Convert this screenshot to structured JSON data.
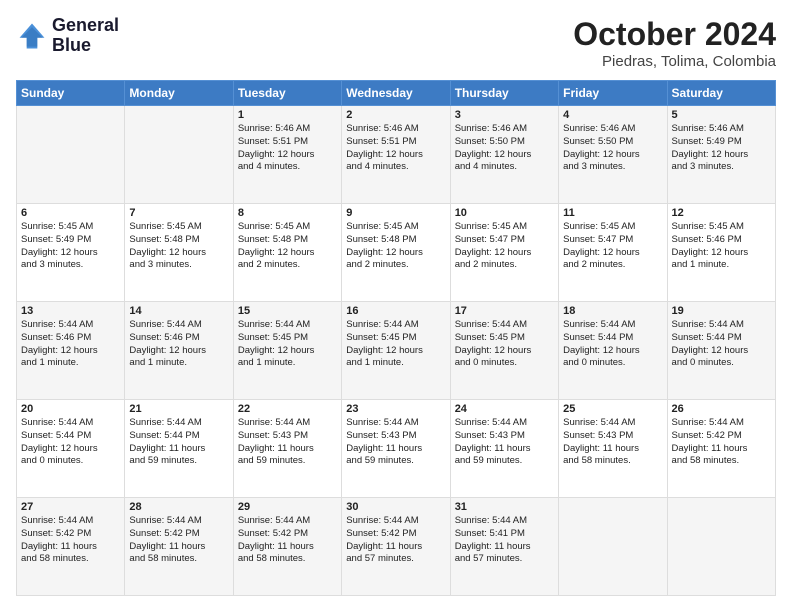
{
  "logo": {
    "line1": "General",
    "line2": "Blue"
  },
  "title": "October 2024",
  "location": "Piedras, Tolima, Colombia",
  "days_header": [
    "Sunday",
    "Monday",
    "Tuesday",
    "Wednesday",
    "Thursday",
    "Friday",
    "Saturday"
  ],
  "weeks": [
    [
      {
        "day": "",
        "content": ""
      },
      {
        "day": "",
        "content": ""
      },
      {
        "day": "1",
        "content": "Sunrise: 5:46 AM\nSunset: 5:51 PM\nDaylight: 12 hours\nand 4 minutes."
      },
      {
        "day": "2",
        "content": "Sunrise: 5:46 AM\nSunset: 5:51 PM\nDaylight: 12 hours\nand 4 minutes."
      },
      {
        "day": "3",
        "content": "Sunrise: 5:46 AM\nSunset: 5:50 PM\nDaylight: 12 hours\nand 4 minutes."
      },
      {
        "day": "4",
        "content": "Sunrise: 5:46 AM\nSunset: 5:50 PM\nDaylight: 12 hours\nand 3 minutes."
      },
      {
        "day": "5",
        "content": "Sunrise: 5:46 AM\nSunset: 5:49 PM\nDaylight: 12 hours\nand 3 minutes."
      }
    ],
    [
      {
        "day": "6",
        "content": "Sunrise: 5:45 AM\nSunset: 5:49 PM\nDaylight: 12 hours\nand 3 minutes."
      },
      {
        "day": "7",
        "content": "Sunrise: 5:45 AM\nSunset: 5:48 PM\nDaylight: 12 hours\nand 3 minutes."
      },
      {
        "day": "8",
        "content": "Sunrise: 5:45 AM\nSunset: 5:48 PM\nDaylight: 12 hours\nand 2 minutes."
      },
      {
        "day": "9",
        "content": "Sunrise: 5:45 AM\nSunset: 5:48 PM\nDaylight: 12 hours\nand 2 minutes."
      },
      {
        "day": "10",
        "content": "Sunrise: 5:45 AM\nSunset: 5:47 PM\nDaylight: 12 hours\nand 2 minutes."
      },
      {
        "day": "11",
        "content": "Sunrise: 5:45 AM\nSunset: 5:47 PM\nDaylight: 12 hours\nand 2 minutes."
      },
      {
        "day": "12",
        "content": "Sunrise: 5:45 AM\nSunset: 5:46 PM\nDaylight: 12 hours\nand 1 minute."
      }
    ],
    [
      {
        "day": "13",
        "content": "Sunrise: 5:44 AM\nSunset: 5:46 PM\nDaylight: 12 hours\nand 1 minute."
      },
      {
        "day": "14",
        "content": "Sunrise: 5:44 AM\nSunset: 5:46 PM\nDaylight: 12 hours\nand 1 minute."
      },
      {
        "day": "15",
        "content": "Sunrise: 5:44 AM\nSunset: 5:45 PM\nDaylight: 12 hours\nand 1 minute."
      },
      {
        "day": "16",
        "content": "Sunrise: 5:44 AM\nSunset: 5:45 PM\nDaylight: 12 hours\nand 1 minute."
      },
      {
        "day": "17",
        "content": "Sunrise: 5:44 AM\nSunset: 5:45 PM\nDaylight: 12 hours\nand 0 minutes."
      },
      {
        "day": "18",
        "content": "Sunrise: 5:44 AM\nSunset: 5:44 PM\nDaylight: 12 hours\nand 0 minutes."
      },
      {
        "day": "19",
        "content": "Sunrise: 5:44 AM\nSunset: 5:44 PM\nDaylight: 12 hours\nand 0 minutes."
      }
    ],
    [
      {
        "day": "20",
        "content": "Sunrise: 5:44 AM\nSunset: 5:44 PM\nDaylight: 12 hours\nand 0 minutes."
      },
      {
        "day": "21",
        "content": "Sunrise: 5:44 AM\nSunset: 5:44 PM\nDaylight: 11 hours\nand 59 minutes."
      },
      {
        "day": "22",
        "content": "Sunrise: 5:44 AM\nSunset: 5:43 PM\nDaylight: 11 hours\nand 59 minutes."
      },
      {
        "day": "23",
        "content": "Sunrise: 5:44 AM\nSunset: 5:43 PM\nDaylight: 11 hours\nand 59 minutes."
      },
      {
        "day": "24",
        "content": "Sunrise: 5:44 AM\nSunset: 5:43 PM\nDaylight: 11 hours\nand 59 minutes."
      },
      {
        "day": "25",
        "content": "Sunrise: 5:44 AM\nSunset: 5:43 PM\nDaylight: 11 hours\nand 58 minutes."
      },
      {
        "day": "26",
        "content": "Sunrise: 5:44 AM\nSunset: 5:42 PM\nDaylight: 11 hours\nand 58 minutes."
      }
    ],
    [
      {
        "day": "27",
        "content": "Sunrise: 5:44 AM\nSunset: 5:42 PM\nDaylight: 11 hours\nand 58 minutes."
      },
      {
        "day": "28",
        "content": "Sunrise: 5:44 AM\nSunset: 5:42 PM\nDaylight: 11 hours\nand 58 minutes."
      },
      {
        "day": "29",
        "content": "Sunrise: 5:44 AM\nSunset: 5:42 PM\nDaylight: 11 hours\nand 58 minutes."
      },
      {
        "day": "30",
        "content": "Sunrise: 5:44 AM\nSunset: 5:42 PM\nDaylight: 11 hours\nand 57 minutes."
      },
      {
        "day": "31",
        "content": "Sunrise: 5:44 AM\nSunset: 5:41 PM\nDaylight: 11 hours\nand 57 minutes."
      },
      {
        "day": "",
        "content": ""
      },
      {
        "day": "",
        "content": ""
      }
    ]
  ]
}
